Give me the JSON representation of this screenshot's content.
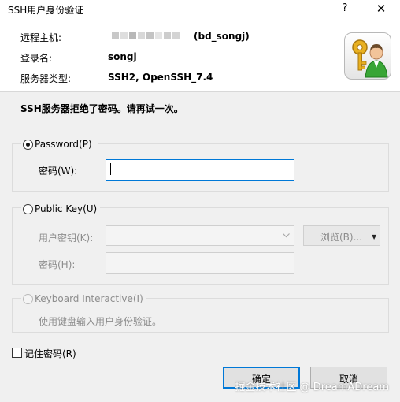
{
  "window": {
    "title": "SSH用户身份验证",
    "help_glyph": "?",
    "close_glyph": "✕"
  },
  "info": {
    "remote_host_label": "远程主机:",
    "remote_host_value": "(bd_songj)",
    "login_label": "登录名:",
    "login_value": "songj",
    "server_type_label": "服务器类型:",
    "server_type_value": "SSH2, OpenSSH_7.4"
  },
  "error_message": "SSH服务器拒绝了密码。请再试一次。",
  "password_group": {
    "radio_label": "Password(P)",
    "field_label": "密码(W):",
    "field_value": "",
    "selected": true
  },
  "public_key_group": {
    "radio_label": "Public Key(U)",
    "key_label": "用户密钥(K):",
    "key_value": "",
    "browse_label": "浏览(B)...",
    "pass_label": "密码(H):",
    "pass_value": ""
  },
  "keyboard_group": {
    "radio_label": "Keyboard Interactive(I)",
    "description": "使用键盘输入用户身份验证。"
  },
  "remember_password": {
    "label": "记住密码(R)",
    "checked": false
  },
  "buttons": {
    "ok_label": "确定",
    "cancel_label": "取消"
  },
  "watermark": "掘金技术社区 @ DreamADream",
  "colors": {
    "dialog_bg": "#f0f0f0",
    "focus_blue": "#0078d7",
    "disabled_text": "#8d8d8d"
  },
  "icons": [
    "help-icon",
    "close-icon",
    "key-user-icon",
    "dropdown-arrow-icon",
    "browse-arrow-icon"
  ]
}
